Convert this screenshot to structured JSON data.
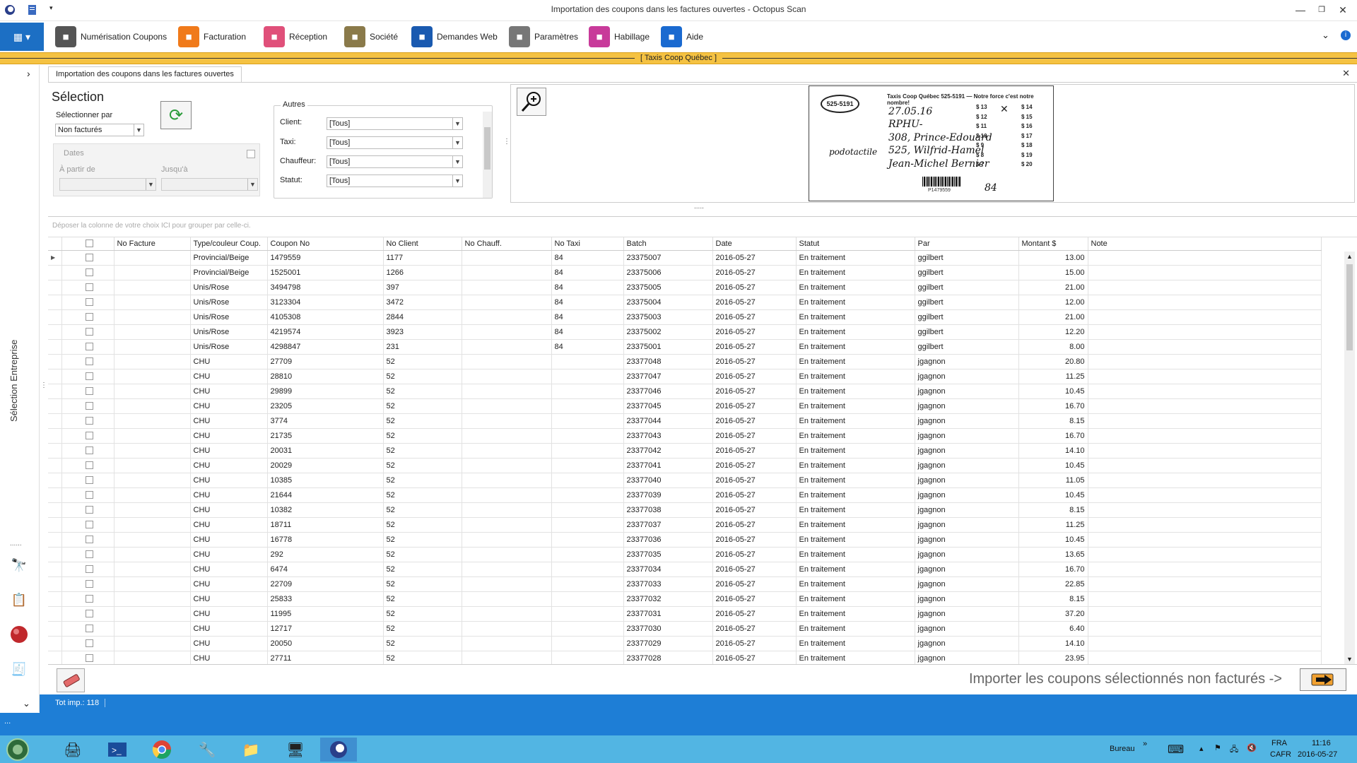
{
  "window": {
    "title": "Importation des coupons dans les factures ouvertes - Octopus Scan"
  },
  "ribbon": {
    "items": [
      {
        "label": "Numérisation Coupons",
        "icon": "scanner-icon",
        "color": "#555555"
      },
      {
        "label": "Facturation",
        "icon": "invoice-icon",
        "color": "#f07a1a"
      },
      {
        "label": "Réception",
        "icon": "house-icon",
        "color": "#e0507a"
      },
      {
        "label": "Société",
        "icon": "company-icon",
        "color": "#8a7a4a"
      },
      {
        "label": "Demandes Web",
        "icon": "globe-icon",
        "color": "#1a5ab0"
      },
      {
        "label": "Paramètres",
        "icon": "tools-icon",
        "color": "#777777"
      },
      {
        "label": "Habillage",
        "icon": "palette-icon",
        "color": "#c83a9a"
      },
      {
        "label": "Aide",
        "icon": "help-icon",
        "color": "#1a6ad0"
      }
    ]
  },
  "company": {
    "label": "[ Taxis Coop Québec ]",
    "color": "#f5c242"
  },
  "leftrail": {
    "label": "Sélection Entreprise"
  },
  "tab": {
    "label": "Importation des coupons dans les factures ouvertes"
  },
  "selection": {
    "title": "Sélection",
    "select_by_label": "Sélectionner par",
    "select_by_value": "Non facturés",
    "dates_label": "Dates",
    "from_label": "À partir de",
    "to_label": "Jusqu'à"
  },
  "autres": {
    "legend": "Autres",
    "client_label": "Client:",
    "client_value": "[Tous]",
    "taxi_label": "Taxi:",
    "taxi_value": "[Tous]",
    "chauffeur_label": "Chauffeur:",
    "chauffeur_value": "[Tous]",
    "statut_label": "Statut:",
    "statut_value": "[Tous]"
  },
  "coupon": {
    "header": "Taxis Coop Québec 525-5191 — Notre force c'est notre nombre!",
    "logo": "525-5191",
    "date": "27.05.16",
    "company": "RPHU-",
    "from": "308, Prince-Edouard",
    "to": "525, Wilfrid-Hamel",
    "signer": "Jean-Michel Bernier",
    "note": "podotactile",
    "barcode": "P1479559",
    "taxi": "84",
    "amounts_left": [
      "$ 13",
      "$ 12",
      "$ 11",
      "$ 10",
      "$ 9",
      "$ 8",
      "$ 7"
    ],
    "amounts_right": [
      "$ 14",
      "$ 15",
      "$ 16",
      "$ 17",
      "$ 18",
      "$ 19",
      "$ 20"
    ]
  },
  "grid": {
    "group_hint": "Déposer la colonne de votre choix ICI pour grouper par celle-ci.",
    "columns": [
      "No Facture",
      "Type/couleur Coup.",
      "Coupon No",
      "No Client",
      "No Chauff.",
      "No Taxi",
      "Batch",
      "Date",
      "Statut",
      "Par",
      "Montant $",
      "Note"
    ],
    "rows": [
      [
        "",
        "Provincial/Beige",
        "1479559",
        "1177",
        "",
        "84",
        "23375007",
        "2016-05-27",
        "En traitement",
        "ggilbert",
        "13.00",
        ""
      ],
      [
        "",
        "Provincial/Beige",
        "1525001",
        "1266",
        "",
        "84",
        "23375006",
        "2016-05-27",
        "En traitement",
        "ggilbert",
        "15.00",
        ""
      ],
      [
        "",
        "Unis/Rose",
        "3494798",
        "397",
        "",
        "84",
        "23375005",
        "2016-05-27",
        "En traitement",
        "ggilbert",
        "21.00",
        ""
      ],
      [
        "",
        "Unis/Rose",
        "3123304",
        "3472",
        "",
        "84",
        "23375004",
        "2016-05-27",
        "En traitement",
        "ggilbert",
        "12.00",
        ""
      ],
      [
        "",
        "Unis/Rose",
        "4105308",
        "2844",
        "",
        "84",
        "23375003",
        "2016-05-27",
        "En traitement",
        "ggilbert",
        "21.00",
        ""
      ],
      [
        "",
        "Unis/Rose",
        "4219574",
        "3923",
        "",
        "84",
        "23375002",
        "2016-05-27",
        "En traitement",
        "ggilbert",
        "12.20",
        ""
      ],
      [
        "",
        "Unis/Rose",
        "4298847",
        "231",
        "",
        "84",
        "23375001",
        "2016-05-27",
        "En traitement",
        "ggilbert",
        "8.00",
        ""
      ],
      [
        "",
        "CHU",
        "27709",
        "52",
        "",
        "",
        "23377048",
        "2016-05-27",
        "En traitement",
        "jgagnon",
        "20.80",
        ""
      ],
      [
        "",
        "CHU",
        "28810",
        "52",
        "",
        "",
        "23377047",
        "2016-05-27",
        "En traitement",
        "jgagnon",
        "11.25",
        ""
      ],
      [
        "",
        "CHU",
        "29899",
        "52",
        "",
        "",
        "23377046",
        "2016-05-27",
        "En traitement",
        "jgagnon",
        "10.45",
        ""
      ],
      [
        "",
        "CHU",
        "23205",
        "52",
        "",
        "",
        "23377045",
        "2016-05-27",
        "En traitement",
        "jgagnon",
        "16.70",
        ""
      ],
      [
        "",
        "CHU",
        "3774",
        "52",
        "",
        "",
        "23377044",
        "2016-05-27",
        "En traitement",
        "jgagnon",
        "8.15",
        ""
      ],
      [
        "",
        "CHU",
        "21735",
        "52",
        "",
        "",
        "23377043",
        "2016-05-27",
        "En traitement",
        "jgagnon",
        "16.70",
        ""
      ],
      [
        "",
        "CHU",
        "20031",
        "52",
        "",
        "",
        "23377042",
        "2016-05-27",
        "En traitement",
        "jgagnon",
        "14.10",
        ""
      ],
      [
        "",
        "CHU",
        "20029",
        "52",
        "",
        "",
        "23377041",
        "2016-05-27",
        "En traitement",
        "jgagnon",
        "10.45",
        ""
      ],
      [
        "",
        "CHU",
        "10385",
        "52",
        "",
        "",
        "23377040",
        "2016-05-27",
        "En traitement",
        "jgagnon",
        "11.05",
        ""
      ],
      [
        "",
        "CHU",
        "21644",
        "52",
        "",
        "",
        "23377039",
        "2016-05-27",
        "En traitement",
        "jgagnon",
        "10.45",
        ""
      ],
      [
        "",
        "CHU",
        "10382",
        "52",
        "",
        "",
        "23377038",
        "2016-05-27",
        "En traitement",
        "jgagnon",
        "8.15",
        ""
      ],
      [
        "",
        "CHU",
        "18711",
        "52",
        "",
        "",
        "23377037",
        "2016-05-27",
        "En traitement",
        "jgagnon",
        "11.25",
        ""
      ],
      [
        "",
        "CHU",
        "16778",
        "52",
        "",
        "",
        "23377036",
        "2016-05-27",
        "En traitement",
        "jgagnon",
        "10.45",
        ""
      ],
      [
        "",
        "CHU",
        "292",
        "52",
        "",
        "",
        "23377035",
        "2016-05-27",
        "En traitement",
        "jgagnon",
        "13.65",
        ""
      ],
      [
        "",
        "CHU",
        "6474",
        "52",
        "",
        "",
        "23377034",
        "2016-05-27",
        "En traitement",
        "jgagnon",
        "16.70",
        ""
      ],
      [
        "",
        "CHU",
        "22709",
        "52",
        "",
        "",
        "23377033",
        "2016-05-27",
        "En traitement",
        "jgagnon",
        "22.85",
        ""
      ],
      [
        "",
        "CHU",
        "25833",
        "52",
        "",
        "",
        "23377032",
        "2016-05-27",
        "En traitement",
        "jgagnon",
        "8.15",
        ""
      ],
      [
        "",
        "CHU",
        "11995",
        "52",
        "",
        "",
        "23377031",
        "2016-05-27",
        "En traitement",
        "jgagnon",
        "37.20",
        ""
      ],
      [
        "",
        "CHU",
        "12717",
        "52",
        "",
        "",
        "23377030",
        "2016-05-27",
        "En traitement",
        "jgagnon",
        "6.40",
        ""
      ],
      [
        "",
        "CHU",
        "20050",
        "52",
        "",
        "",
        "23377029",
        "2016-05-27",
        "En traitement",
        "jgagnon",
        "14.10",
        ""
      ],
      [
        "",
        "CHU",
        "27711",
        "52",
        "",
        "",
        "23377028",
        "2016-05-27",
        "En traitement",
        "jgagnon",
        "23.95",
        ""
      ]
    ]
  },
  "bottom": {
    "import_label": "Importer les coupons sélectionnés non facturés ->"
  },
  "status": {
    "count": "Tot imp.: 118",
    "extra": "..."
  },
  "taskbar": {
    "desktop": "Bureau",
    "lang": "FRA",
    "layout": "CAFR",
    "time": "11:16",
    "date": "2016-05-27",
    "color": "#52b5e3"
  }
}
